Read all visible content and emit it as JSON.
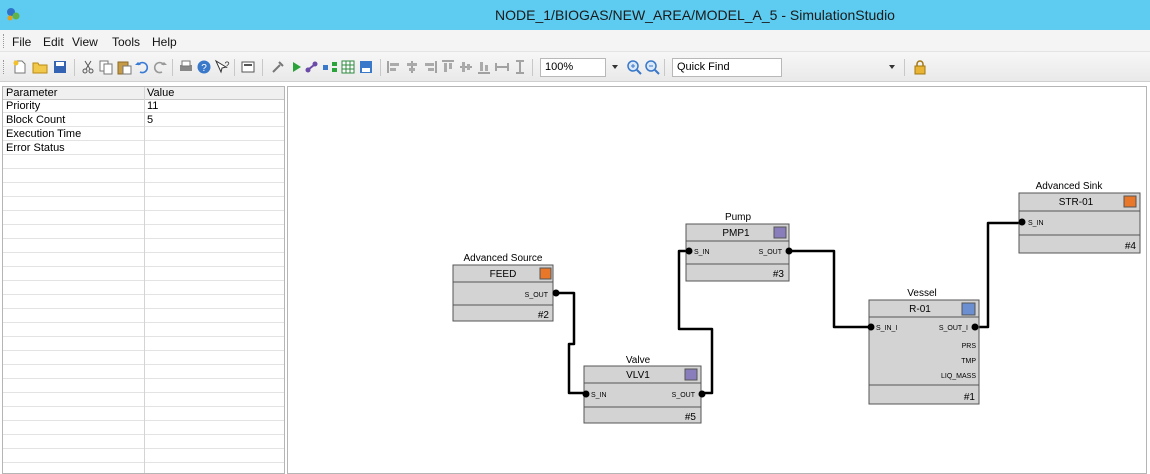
{
  "window": {
    "title": "NODE_1/BIOGAS/NEW_AREA/MODEL_A_5 - SimulationStudio",
    "title_bar_color": "#5ecbf0"
  },
  "menu": {
    "file": "File",
    "edit": "Edit",
    "view": "View",
    "tools": "Tools",
    "help": "Help"
  },
  "toolbar": {
    "zoom_value": "100%",
    "quick_find_label": "Quick Find",
    "icons": [
      "new-icon",
      "open-icon",
      "save-icon",
      "cut-icon",
      "copy-icon",
      "paste-icon",
      "undo-icon",
      "redo-icon",
      "print-icon",
      "help-icon",
      "context-help-icon",
      "properties-icon",
      "tools-icon",
      "run-icon",
      "connect-icon",
      "flow-icon",
      "grid-icon",
      "palette-icon",
      "align-left-icon",
      "align-center-icon",
      "align-right-icon",
      "align-top-icon",
      "align-middle-icon",
      "align-bottom-icon",
      "same-width-icon",
      "same-height-icon",
      "zoom-in-icon",
      "zoom-out-icon",
      "lock-icon"
    ]
  },
  "parameter_grid": {
    "headers": {
      "parameter": "Parameter",
      "value": "Value"
    },
    "rows": [
      {
        "parameter": "Priority",
        "value": "11"
      },
      {
        "parameter": "Block Count",
        "value": "5"
      },
      {
        "parameter": "Execution Time",
        "value": ""
      },
      {
        "parameter": "Error Status",
        "value": ""
      }
    ]
  },
  "diagram": {
    "blocks": {
      "source": {
        "caption": "Advanced Source",
        "name": "FEED",
        "port_out": "S_OUT",
        "number": "#2"
      },
      "valve": {
        "caption": "Valve",
        "name": "VLV1",
        "port_in": "S_IN",
        "port_out": "S_OUT",
        "number": "#5"
      },
      "pump": {
        "caption": "Pump",
        "name": "PMP1",
        "port_in": "S_IN",
        "port_out": "S_OUT",
        "number": "#3"
      },
      "vessel": {
        "caption": "Vessel",
        "name": "R-01",
        "port_in": "S_IN_I",
        "port_out": "S_OUT_I",
        "out_prs": "PRS",
        "out_tmp": "TMP",
        "out_liq": "LIQ_MASS",
        "number": "#1"
      },
      "sink": {
        "caption": "Advanced Sink",
        "name": "STR-01",
        "port_in": "S_IN",
        "number": "#4"
      }
    },
    "colors": {
      "block_fill": "#d3d3d3",
      "block_border": "#555555",
      "wire": "#000000"
    }
  }
}
